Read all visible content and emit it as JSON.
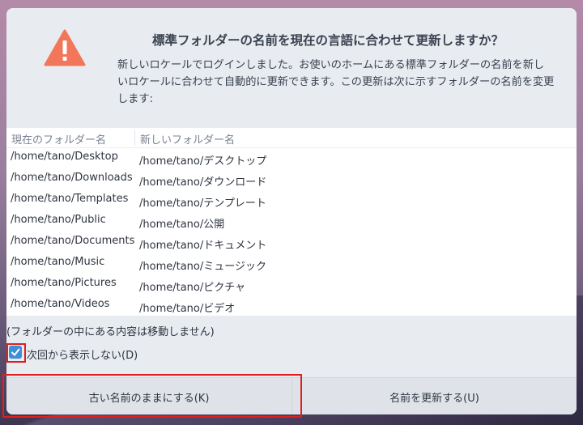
{
  "dialog": {
    "title": "標準フォルダーの名前を現在の言語に合わせて更新しますか？",
    "description": "新しいロケールでログインしました。お使いのホームにある標準フォルダーの名前を新しいロケールに合わせて自動的に更新できます。この更新は次に示すフォルダーの名前を変更します:",
    "icon": "warning-icon",
    "accent_color": "#f2775a"
  },
  "table": {
    "headers": [
      "現在のフォルダー名",
      "新しいフォルダー名"
    ],
    "rows": [
      {
        "old": "/home/tano/Desktop",
        "new": "/home/tano/デスクトップ"
      },
      {
        "old": "/home/tano/Downloads",
        "new": "/home/tano/ダウンロード"
      },
      {
        "old": "/home/tano/Templates",
        "new": "/home/tano/テンプレート"
      },
      {
        "old": "/home/tano/Public",
        "new": "/home/tano/公開"
      },
      {
        "old": "/home/tano/Documents",
        "new": "/home/tano/ドキュメント"
      },
      {
        "old": "/home/tano/Music",
        "new": "/home/tano/ミュージック"
      },
      {
        "old": "/home/tano/Pictures",
        "new": "/home/tano/ピクチャ"
      },
      {
        "old": "/home/tano/Videos",
        "new": "/home/tano/ビデオ"
      }
    ]
  },
  "note": "(フォルダーの中にある内容は移動しません)",
  "checkbox": {
    "label": "次回から表示しない(D)",
    "checked": true,
    "color": "#3d8fd8"
  },
  "buttons": {
    "keep_label": "古い名前のままにする(K)",
    "update_label": "名前を更新する(U)"
  }
}
